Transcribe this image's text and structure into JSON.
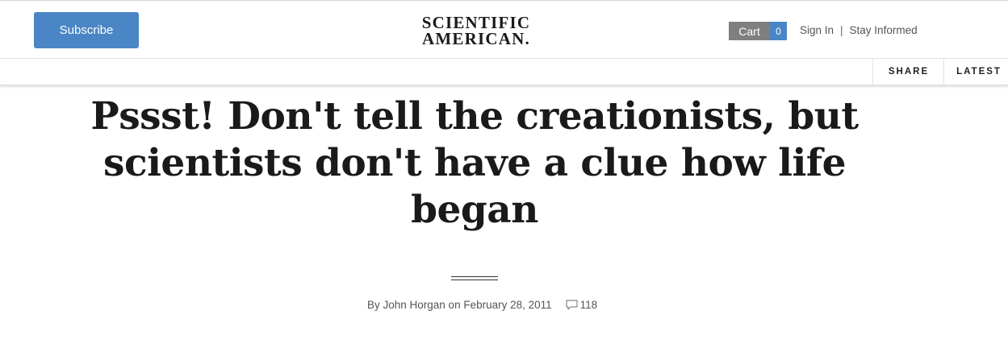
{
  "header": {
    "subscribe_label": "Subscribe",
    "logo_line1": "SCIENTIFIC",
    "logo_line2": "AMERICAN.",
    "cart_label": "Cart",
    "cart_count": "0",
    "sign_in": "Sign In",
    "separator": "|",
    "stay_informed": "Stay Informed"
  },
  "nav": {
    "share": "SHARE",
    "latest": "LATEST"
  },
  "article": {
    "title": "Pssst! Don't tell the creationists, but scientists don't have a clue how life began",
    "byline": "By John Horgan on February 28, 2011",
    "comment_count": "118"
  },
  "colors": {
    "accent_blue": "#4a86c5",
    "cart_gray": "#7f7f7f"
  },
  "icons": {
    "comments": "speech-bubble-icon"
  }
}
